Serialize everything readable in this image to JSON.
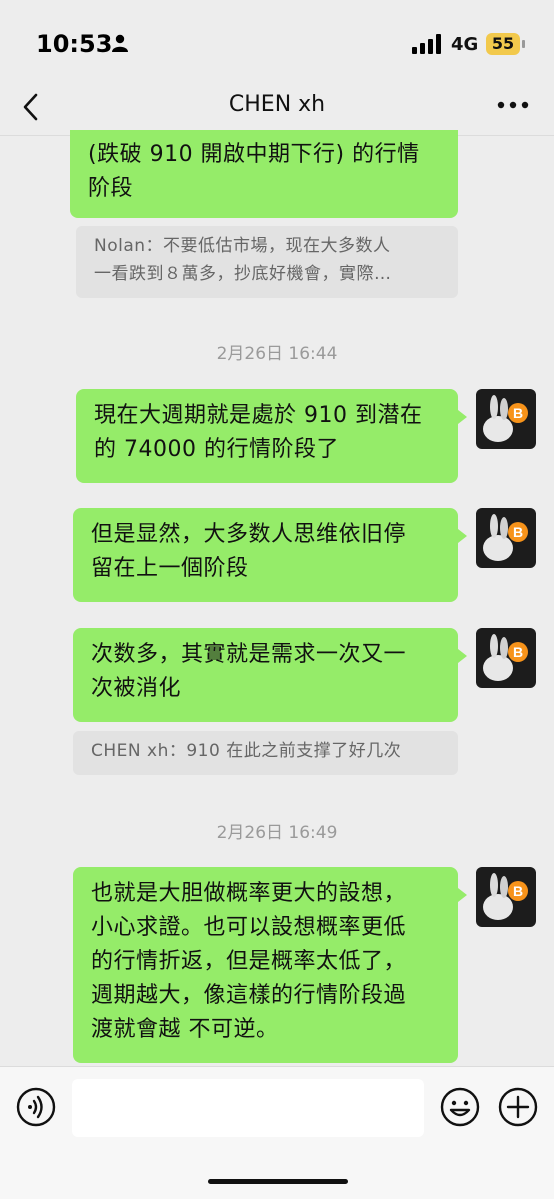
{
  "status_bar": {
    "time": "10:53",
    "network": "4G",
    "battery": "55"
  },
  "header": {
    "title": "CHEN xh"
  },
  "messages": [
    {
      "type": "text",
      "lines": [
        "(跌破 910 開啟中期下行) 的行情",
        "阶段"
      ]
    },
    {
      "type": "quote",
      "lines": [
        "Nolan：不要低估市場，现在大多数人",
        "一看跌到８萬多，抄底好機會，實際…"
      ]
    },
    {
      "type": "time",
      "text": "2月26日 16:44"
    },
    {
      "type": "text",
      "lines": [
        "現在大週期就是處於 910 到潜在",
        "的 74000 的行情阶段了"
      ]
    },
    {
      "type": "text",
      "lines": [
        "但是显然，大多数人思维依旧停",
        "留在上一個阶段"
      ]
    },
    {
      "type": "text",
      "lines": [
        "次数多，其實就是需求一次又一",
        "次被消化"
      ]
    },
    {
      "type": "quote",
      "lines": [
        "CHEN xh：910 在此之前支撑了好几次"
      ]
    },
    {
      "type": "time",
      "text": "2月26日 16:49"
    },
    {
      "type": "text",
      "lines": [
        "也就是大胆做概率更大的設想，",
        "小心求證。也可以設想概率更低",
        "的行情折返，但是概率太低了，",
        "週期越大，像這樣的行情阶段過",
        "渡就會越 不可逆。"
      ]
    }
  ],
  "avatar": {
    "badge": "B"
  },
  "input": {
    "placeholder": ""
  },
  "colors": {
    "bubble": "#95ec69",
    "background": "#ededed",
    "quote": "#e2e2e2",
    "battery": "#f2c94c"
  }
}
